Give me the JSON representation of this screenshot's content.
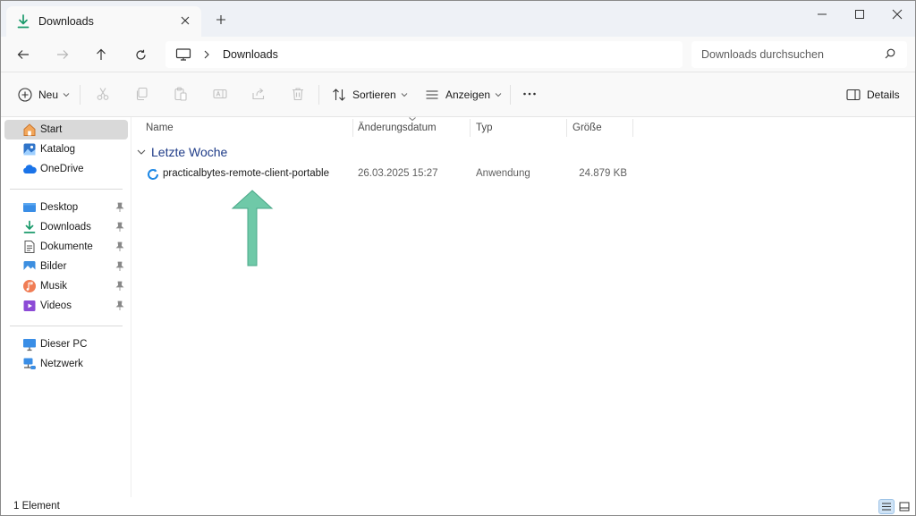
{
  "window": {
    "tab_label": "Downloads",
    "colors": {
      "accent": "#1f3c88",
      "arrow": "#6fc9a8",
      "selected_bg": "#d9d9d9"
    }
  },
  "address": {
    "location_icon": "pc-icon",
    "path": [
      "Downloads"
    ],
    "search_placeholder": "Downloads durchsuchen"
  },
  "toolbar": {
    "new_label": "Neu",
    "sort_label": "Sortieren",
    "view_label": "Anzeigen",
    "details_label": "Details",
    "disabled_icons": [
      "cut-icon",
      "copy-icon",
      "paste-icon",
      "rename-icon",
      "share-icon",
      "delete-icon"
    ]
  },
  "sidebar": {
    "top": [
      {
        "label": "Start",
        "icon": "home-icon",
        "selected": true
      },
      {
        "label": "Katalog",
        "icon": "gallery-icon"
      },
      {
        "label": "OneDrive",
        "icon": "cloud-icon"
      }
    ],
    "quick_access": [
      {
        "label": "Desktop",
        "icon": "desktop-icon",
        "pinned": true
      },
      {
        "label": "Downloads",
        "icon": "download-icon",
        "pinned": true
      },
      {
        "label": "Dokumente",
        "icon": "documents-icon",
        "pinned": true
      },
      {
        "label": "Bilder",
        "icon": "pictures-icon",
        "pinned": true
      },
      {
        "label": "Musik",
        "icon": "music-icon",
        "pinned": true
      },
      {
        "label": "Videos",
        "icon": "videos-icon",
        "pinned": true
      }
    ],
    "devices": [
      {
        "label": "Dieser PC",
        "icon": "pc-icon"
      },
      {
        "label": "Netzwerk",
        "icon": "network-icon"
      }
    ]
  },
  "content": {
    "columns": [
      "Name",
      "Änderungsdatum",
      "Typ",
      "Größe"
    ],
    "sorted_by": "Änderungsdatum",
    "groups": [
      {
        "label": "Letzte Woche",
        "expanded": true,
        "files": [
          {
            "name": "practicalbytes-remote-client-portable",
            "modified": "26.03.2025 15:27",
            "type": "Anwendung",
            "size": "24.879 KB",
            "icon": "app-refresh-icon"
          }
        ]
      }
    ]
  },
  "status": {
    "count_text": "1 Element",
    "active_view": "details"
  }
}
